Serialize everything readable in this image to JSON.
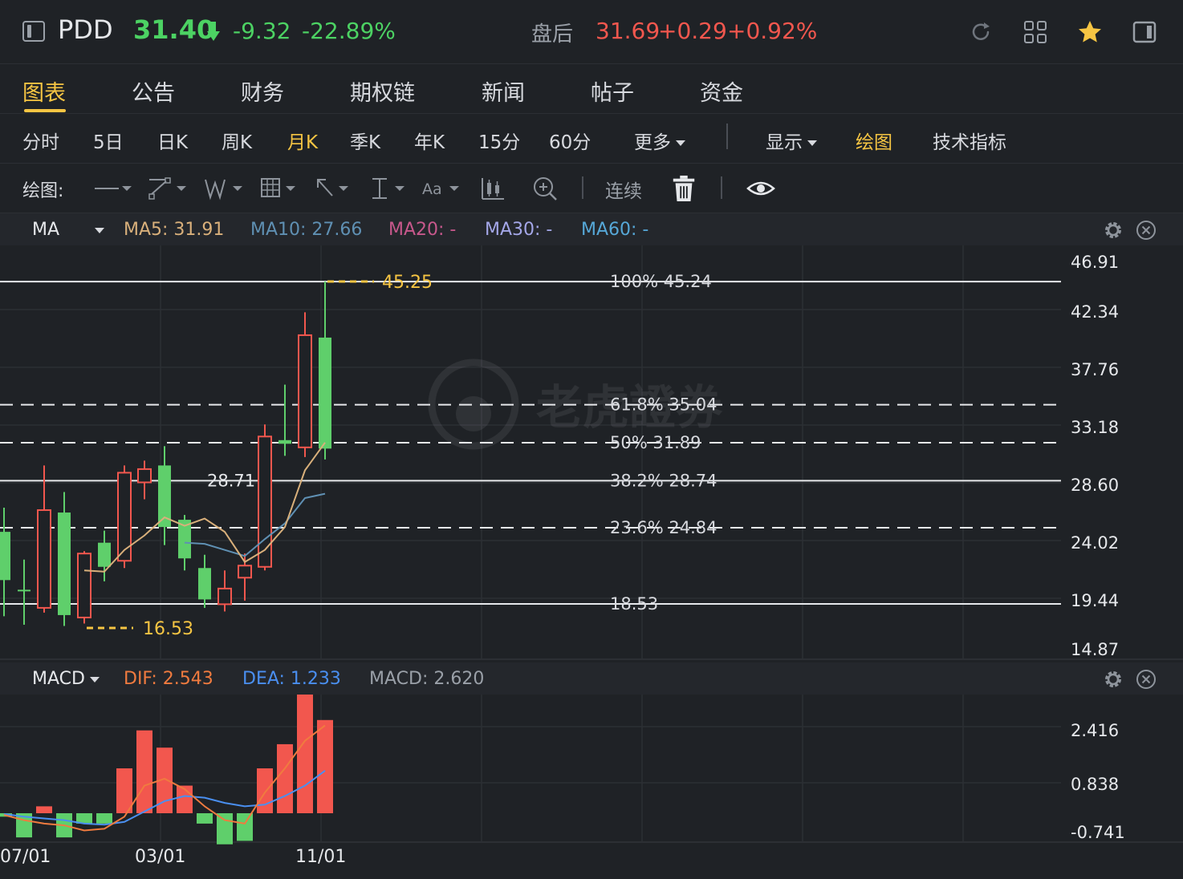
{
  "header": {
    "ticker": "PDD",
    "last_price": "31.40",
    "change_abs": "-9.32",
    "change_pct": "-22.89%",
    "after_hours_label": "盘后",
    "after_hours_price": "31.69",
    "after_hours_change": "+0.29",
    "after_hours_pct": "+0.92%",
    "icons": [
      "sidebar-toggle-icon",
      "refresh-icon",
      "grid-icon",
      "star-icon",
      "panel-icon"
    ]
  },
  "tabs": [
    {
      "label": "图表",
      "active": true
    },
    {
      "label": "公告"
    },
    {
      "label": "财务"
    },
    {
      "label": "期权链"
    },
    {
      "label": "新闻"
    },
    {
      "label": "帖子"
    },
    {
      "label": "资金"
    }
  ],
  "periods": [
    {
      "label": "分时"
    },
    {
      "label": "5日"
    },
    {
      "label": "日K"
    },
    {
      "label": "周K"
    },
    {
      "label": "月K",
      "active": true
    },
    {
      "label": "季K"
    },
    {
      "label": "年K"
    },
    {
      "label": "15分"
    },
    {
      "label": "60分"
    },
    {
      "label": "更多"
    }
  ],
  "period_right": {
    "display": "显示",
    "draw": "绘图",
    "indicators": "技术指标"
  },
  "toolbar": {
    "label": "绘图:",
    "continuous": "连续",
    "tools": [
      "line-tool-icon",
      "trend-tool-icon",
      "wave-tool-icon",
      "grid-tool-icon",
      "arrow-tool-icon",
      "range-tool-icon",
      "text-tool-icon",
      "candle-tool-icon",
      "zoom-icon",
      "trash-icon",
      "eye-icon"
    ]
  },
  "ma_legend": {
    "name": "MA",
    "items": [
      {
        "label": "MA5: 31.91",
        "color": "#d9b07b"
      },
      {
        "label": "MA10: 27.66",
        "color": "#5f90b3"
      },
      {
        "label": "MA20: -",
        "color": "#c8588c"
      },
      {
        "label": "MA30: -",
        "color": "#a4a7e8"
      },
      {
        "label": "MA60: -",
        "color": "#56a8d8"
      }
    ]
  },
  "macd_legend": {
    "name": "MACD",
    "items": [
      {
        "label": "DIF: 2.543",
        "color": "#f07b3f"
      },
      {
        "label": "DEA: 1.233",
        "color": "#4a8ff0"
      },
      {
        "label": "MACD: 2.620",
        "color": "#9aa0a8"
      }
    ]
  },
  "chart_data": [
    {
      "type": "candlestick",
      "title": "",
      "ylim": [
        14.87,
        46.91
      ],
      "y_ticks": [
        "46.91",
        "42.34",
        "37.76",
        "33.18",
        "28.60",
        "24.02",
        "19.44",
        "14.87"
      ],
      "x_ticks": [
        "07/01",
        "03/01",
        "11/01"
      ],
      "candles": [
        {
          "o": 24.5,
          "c": 20.5,
          "h": 26.5,
          "l": 17.5
        },
        {
          "o": 19.7,
          "c": 19.6,
          "h": 22.2,
          "l": 16.8
        },
        {
          "o": 18.2,
          "c": 26.3,
          "h": 30.0,
          "l": 17.8
        },
        {
          "o": 26.1,
          "c": 17.6,
          "h": 27.8,
          "l": 16.7
        },
        {
          "o": 17.4,
          "c": 22.7,
          "h": 22.9,
          "l": 16.9
        },
        {
          "o": 23.6,
          "c": 21.6,
          "h": 24.6,
          "l": 20.4
        },
        {
          "o": 22.1,
          "c": 29.4,
          "h": 30.0,
          "l": 21.5
        },
        {
          "o": 28.6,
          "c": 29.7,
          "h": 30.4,
          "l": 27.2
        },
        {
          "o": 30.0,
          "c": 24.9,
          "h": 31.6,
          "l": 23.4
        },
        {
          "o": 25.5,
          "c": 22.3,
          "h": 25.9,
          "l": 21.3
        },
        {
          "o": 21.5,
          "c": 18.9,
          "h": 22.6,
          "l": 18.2
        },
        {
          "o": 18.5,
          "c": 19.8,
          "h": 21.3,
          "l": 17.9
        },
        {
          "o": 20.7,
          "c": 21.7,
          "h": 22.7,
          "l": 18.8
        },
        {
          "o": 21.6,
          "c": 32.4,
          "h": 33.4,
          "l": 21.3
        },
        {
          "o": 32.1,
          "c": 31.8,
          "h": 36.7,
          "l": 30.8
        },
        {
          "o": 31.5,
          "c": 40.8,
          "h": 42.7,
          "l": 30.7
        },
        {
          "o": 40.6,
          "c": 31.4,
          "h": 45.25,
          "l": 30.5
        }
      ],
      "ma5": [
        null,
        null,
        null,
        null,
        21.3,
        21.2,
        23.0,
        24.2,
        25.7,
        25.0,
        25.6,
        24.5,
        22.0,
        23.0,
        24.9,
        29.6,
        31.9
      ],
      "ma10": [
        null,
        null,
        null,
        null,
        null,
        null,
        null,
        null,
        null,
        23.6,
        23.5,
        23.0,
        22.5,
        23.9,
        25.2,
        27.3,
        27.66
      ],
      "high_marker": "45.25",
      "low_marker": "16.53",
      "level_marker": "28.71",
      "fib_levels": [
        {
          "label": "100% 45.24",
          "value": 45.24,
          "dashed": false
        },
        {
          "label": "61.8% 35.04",
          "value": 35.04,
          "dashed": true
        },
        {
          "label": "50% 31.89",
          "value": 31.89,
          "dashed": true
        },
        {
          "label": "38.2% 28.74",
          "value": 28.74,
          "dashed": false
        },
        {
          "label": "23.6% 24.84",
          "value": 24.84,
          "dashed": true
        },
        {
          "label": "18.53",
          "value": 18.53,
          "dashed": false
        }
      ]
    },
    {
      "type": "bar",
      "title": "",
      "ylim": [
        -1.5,
        3.6
      ],
      "y_ticks": [
        "2.416",
        "0.838",
        "-0.741"
      ],
      "macd": [
        -0.1,
        -0.7,
        0.2,
        -0.7,
        -0.3,
        -0.3,
        1.3,
        2.4,
        1.9,
        0.8,
        -0.3,
        -0.9,
        -0.8,
        1.3,
        2.0,
        3.6,
        2.7
      ],
      "dif": [
        -0.05,
        -0.2,
        -0.3,
        -0.35,
        -0.5,
        -0.45,
        -0.1,
        0.8,
        1.0,
        0.7,
        0.2,
        -0.2,
        -0.3,
        0.6,
        1.3,
        2.1,
        2.543
      ],
      "dea": [
        -0.02,
        -0.1,
        -0.15,
        -0.2,
        -0.3,
        -0.33,
        -0.25,
        0.05,
        0.35,
        0.5,
        0.45,
        0.3,
        0.2,
        0.25,
        0.5,
        0.8,
        1.233
      ]
    }
  ],
  "watermark": "老虎證券"
}
